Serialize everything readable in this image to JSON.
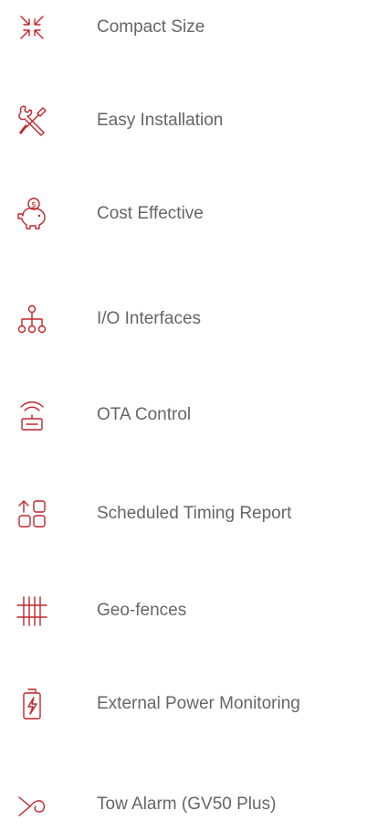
{
  "accent_color": "#c0262c",
  "text_color": "#666666",
  "features": [
    {
      "icon": "compact-arrows-icon",
      "label": "Compact Size"
    },
    {
      "icon": "tools-icon",
      "label": "Easy Installation"
    },
    {
      "icon": "piggy-bank-icon",
      "label": "Cost Effective"
    },
    {
      "icon": "network-tree-icon",
      "label": "I/O Interfaces"
    },
    {
      "icon": "wireless-device-icon",
      "label": "OTA Control"
    },
    {
      "icon": "grid-upload-icon",
      "label": "Scheduled Timing Report"
    },
    {
      "icon": "fence-icon",
      "label": "Geo-fences"
    },
    {
      "icon": "battery-charge-icon",
      "label": "External Power Monitoring"
    },
    {
      "icon": "tow-hook-icon",
      "label": "Tow Alarm (GV50 Plus)"
    }
  ]
}
